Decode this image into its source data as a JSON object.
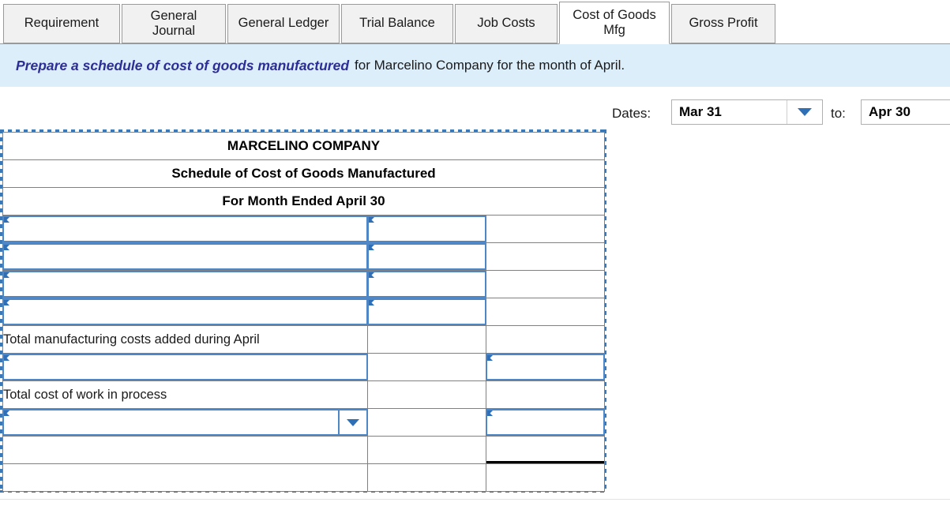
{
  "tabs": [
    {
      "label": "Requirement",
      "active": false
    },
    {
      "label": "General Journal",
      "active": false
    },
    {
      "label": "General Ledger",
      "active": false
    },
    {
      "label": "Trial Balance",
      "active": false
    },
    {
      "label": "Job Costs",
      "active": false
    },
    {
      "label": "Cost of Goods Mfg",
      "active": true
    },
    {
      "label": "Gross Profit",
      "active": false
    }
  ],
  "instruction": {
    "emphasis": "Prepare a schedule of cost of goods manufactured",
    "rest": "for Marcelino Company for the month of April."
  },
  "dates": {
    "label": "Dates:",
    "from_value": "Mar 31",
    "to_label": "to:",
    "to_value": "Apr 30",
    "dropdown_icon": "chevron-down-icon"
  },
  "worksheet": {
    "title_rows": [
      "MARCELINO COMPANY",
      "Schedule of Cost of Goods Manufactured",
      "For Month Ended April 30"
    ],
    "rows": [
      {
        "type": "input",
        "col1": "",
        "col2_input": true,
        "col3_input": false,
        "col3_rule": "none"
      },
      {
        "type": "input",
        "col1": "",
        "col2_input": true,
        "col3_input": false,
        "col3_rule": "none"
      },
      {
        "type": "input",
        "col1": "",
        "col2_input": true,
        "col3_input": false,
        "col3_rule": "none"
      },
      {
        "type": "input",
        "col1": "",
        "col2_input": true,
        "col3_input": false,
        "col3_rule": "none"
      },
      {
        "type": "label",
        "col1": "Total manufacturing costs added during April",
        "col2_input": false,
        "col3_input": false,
        "col3_rule": "none"
      },
      {
        "type": "input",
        "col1": "",
        "col2_input": false,
        "col3_input": true,
        "col3_rule": "single"
      },
      {
        "type": "label",
        "col1": "Total cost of work in process",
        "col2_input": false,
        "col3_input": false,
        "col3_rule": "none"
      },
      {
        "type": "select",
        "col1": "",
        "col2_input": false,
        "col3_input": true,
        "col3_rule": "single"
      },
      {
        "type": "blank",
        "col1": "",
        "col2_input": false,
        "col3_input": false,
        "col3_rule": "double"
      },
      {
        "type": "blank",
        "col1": "",
        "col2_input": false,
        "col3_input": false,
        "col3_rule": "none"
      }
    ]
  },
  "colors": {
    "header_blue": "#6FA8DC",
    "banner_blue": "#DDEEFB",
    "accent_blue": "#2F6FB5",
    "input_border": "#4F86C6",
    "emphasis_text": "#2D2D96"
  }
}
